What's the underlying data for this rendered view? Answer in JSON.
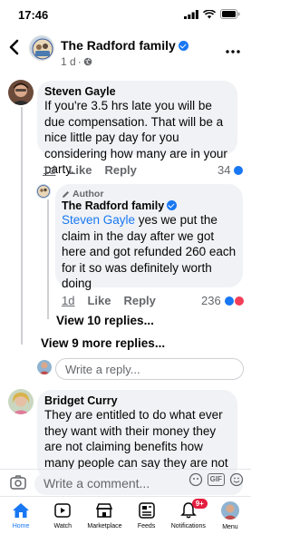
{
  "status": {
    "time": "17:46"
  },
  "header": {
    "page_name": "The Radford family",
    "age": "1 d",
    "dot": "·"
  },
  "comments": [
    {
      "author": "Steven Gayle",
      "text": "If you're 3.5 hrs late you will be due compensation. That will be a nice little pay day for you considering how many are in your party.",
      "time": "1d",
      "like_label": "Like",
      "reply_label": "Reply",
      "reaction_count": "34"
    },
    {
      "badge": "Author",
      "author": "The Radford family",
      "mention": "Steven Gayle",
      "text": " yes we put the claim in the day after we got here and got refunded 260 each for it so was definitely worth doing",
      "time": "1d",
      "like_label": "Like",
      "reply_label": "Reply",
      "reaction_count": "236"
    },
    {
      "author": "Bridget Curry",
      "text": "They are entitled to do what ever they want with their money they are not claiming benefits  how many people can say they are not on"
    }
  ],
  "links": {
    "view_replies": "View 10 replies...",
    "view_more_replies": "View 9 more replies..."
  },
  "reply_box": {
    "placeholder": "Write a reply..."
  },
  "composer": {
    "placeholder": "Write a comment...",
    "gif_label": "GIF"
  },
  "tabs": [
    {
      "label": "Home",
      "icon": "home-icon"
    },
    {
      "label": "Watch",
      "icon": "watch-icon"
    },
    {
      "label": "Marketplace",
      "icon": "marketplace-icon"
    },
    {
      "label": "Feeds",
      "icon": "feeds-icon"
    },
    {
      "label": "Notifications",
      "icon": "bell-icon",
      "badge": "9+"
    },
    {
      "label": "Menu",
      "icon": "menu-avatar"
    }
  ],
  "colors": {
    "accent": "#1877f2",
    "bubble": "#f0f2f5",
    "muted": "#65676b",
    "badge": "#e41e3f"
  }
}
